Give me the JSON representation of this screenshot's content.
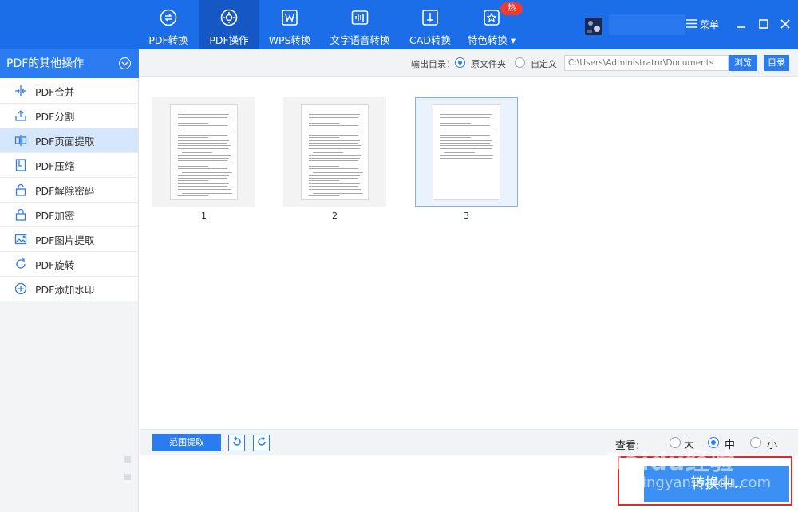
{
  "nav": [
    {
      "label": "PDF转换",
      "icon": "pdf-convert-icon"
    },
    {
      "label": "PDF操作",
      "icon": "pdf-operate-icon"
    },
    {
      "label": "WPS转换",
      "icon": "wps-icon"
    },
    {
      "label": "文字语音转换",
      "icon": "voice-wave-icon"
    },
    {
      "label": "CAD转换",
      "icon": "cad-icon"
    },
    {
      "label": "特色转换",
      "icon": "star-icon"
    }
  ],
  "hot_badge": "热",
  "menu_label": "菜单",
  "sidebar": {
    "title": "PDF的其他操作",
    "items": [
      {
        "label": "PDF合并",
        "icon": "merge-icon"
      },
      {
        "label": "PDF分割",
        "icon": "split-icon"
      },
      {
        "label": "PDF页面提取",
        "icon": "page-extract-icon"
      },
      {
        "label": "PDF压缩",
        "icon": "compress-icon"
      },
      {
        "label": "PDF解除密码",
        "icon": "unlock-icon"
      },
      {
        "label": "PDF加密",
        "icon": "lock-icon"
      },
      {
        "label": "PDF图片提取",
        "icon": "image-extract-icon"
      },
      {
        "label": "PDF旋转",
        "icon": "rotate-icon"
      },
      {
        "label": "PDF添加水印",
        "icon": "add-watermark-icon"
      }
    ]
  },
  "output": {
    "label": "输出目录：",
    "option_original": "原文件夹",
    "option_custom": "自定义",
    "path_placeholder": "C:\\Users\\Administrator\\Documents",
    "browse_label": "浏览",
    "dir_label": "目录"
  },
  "pages": [
    {
      "number": "1"
    },
    {
      "number": "2"
    },
    {
      "number": "3"
    }
  ],
  "bottom": {
    "range_extract_label": "范围提取",
    "view_label": "查看:",
    "size_large": "大",
    "size_medium": "中",
    "size_small": "小"
  },
  "convert_label": "转换中..",
  "watermark_text": "Baidu经验",
  "watermark_url": "jingyan.baidu.com",
  "colors": {
    "brand_blue": "#1c6ee8",
    "sidebar_head": "#2b7cf0",
    "convert_button": "#3c8ff3",
    "highlight_red": "#e02a2a",
    "hot_badge": "#f23a2f"
  }
}
